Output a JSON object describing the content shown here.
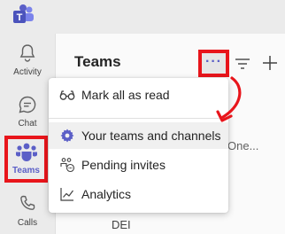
{
  "rail": {
    "items": [
      {
        "label": "Activity",
        "icon": "bell-icon"
      },
      {
        "label": "Chat",
        "icon": "chat-icon"
      },
      {
        "label": "Teams",
        "icon": "teams-icon",
        "selected": true
      },
      {
        "label": "Calls",
        "icon": "phone-icon"
      }
    ]
  },
  "panel": {
    "title": "Teams",
    "more_button": "···",
    "background_texts": [
      "One...",
      "DEI"
    ]
  },
  "menu": {
    "items": [
      {
        "label": "Mark all as read",
        "icon": "glasses-icon"
      },
      {
        "label": "Your teams and channels",
        "icon": "gear-icon"
      },
      {
        "label": "Pending invites",
        "icon": "pending-invites-icon"
      },
      {
        "label": "Analytics",
        "icon": "analytics-icon"
      }
    ]
  },
  "colors": {
    "accent": "#5b5fc7",
    "highlight_red": "#e8151b"
  }
}
